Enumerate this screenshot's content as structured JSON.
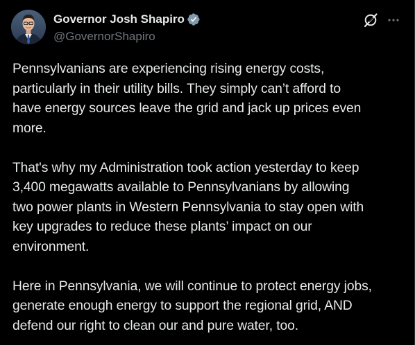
{
  "author": {
    "display_name": "Governor Josh Shapiro",
    "handle": "@GovernorShapiro",
    "verified_icon": "verified-badge-icon",
    "badge_color": "#829aab"
  },
  "actions": {
    "grok_icon": "grok-icon",
    "more_icon": "more-options-icon"
  },
  "post": {
    "paragraphs": [
      "Pennsylvanians are experiencing rising energy costs,\nparticularly in their utility bills. They simply can’t afford to\nhave energy sources leave the grid and jack up prices even\nmore.",
      "That's why my Administration took action yesterday to keep\n3,400 megawatts available to Pennsylvanians by allowing\ntwo power plants in Western Pennsylvania to stay open with\nkey upgrades to reduce these plants’ impact on our\nenvironment.",
      "Here in Pennsylvania, we will continue to protect energy jobs,\ngenerate enough energy to support the regional grid, AND\ndefend our right to clean our and pure water, too."
    ]
  },
  "colors": {
    "background": "#000000",
    "text": "#e7e9ea",
    "secondary_text": "#71767b"
  }
}
